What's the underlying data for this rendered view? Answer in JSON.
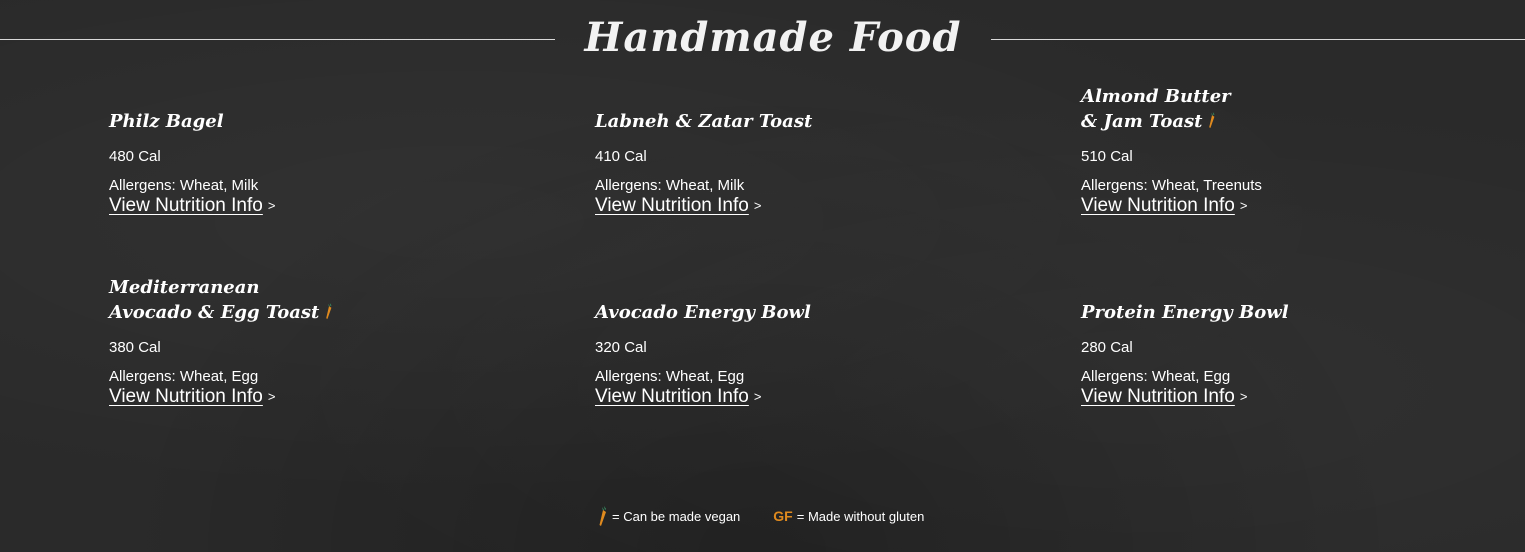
{
  "header": {
    "title": "Handmade Food"
  },
  "items": [
    {
      "name_line1": "Philz Bagel",
      "name_line2": "",
      "vegan": false,
      "calories": "480 Cal",
      "allergens": "Allergens: Wheat, Milk",
      "link": "View Nutrition Info",
      "chevron": ">"
    },
    {
      "name_line1": "Labneh & Zatar Toast",
      "name_line2": "",
      "vegan": false,
      "calories": "410 Cal",
      "allergens": "Allergens: Wheat, Milk",
      "link": "View Nutrition Info",
      "chevron": ">"
    },
    {
      "name_line1": "Almond Butter",
      "name_line2": "& Jam Toast",
      "vegan": true,
      "calories": "510 Cal",
      "allergens": "Allergens: Wheat, Treenuts",
      "link": "View Nutrition Info",
      "chevron": ">"
    },
    {
      "name_line1": "Mediterranean",
      "name_line2": "Avocado & Egg Toast",
      "vegan": true,
      "calories": "380 Cal",
      "allergens": "Allergens: Wheat, Egg",
      "link": "View Nutrition Info",
      "chevron": ">"
    },
    {
      "name_line1": "Avocado Energy Bowl",
      "name_line2": "",
      "vegan": false,
      "calories": "320 Cal",
      "allergens": "Allergens: Wheat, Egg",
      "link": "View Nutrition Info",
      "chevron": ">"
    },
    {
      "name_line1": "Protein Energy Bowl",
      "name_line2": "",
      "vegan": false,
      "calories": "280 Cal",
      "allergens": "Allergens: Wheat, Egg",
      "link": "View Nutrition Info",
      "chevron": ">"
    }
  ],
  "legend": {
    "vegan_text": "= Can be made vegan",
    "gf_mark": "GF",
    "gf_text": "= Made without gluten",
    "vegan_icon": "carrot-icon"
  },
  "colors": {
    "background": "#2a2a2a",
    "text": "#ffffff",
    "accent_orange": "#e08a1e",
    "carrot_green": "#3a9b6a"
  }
}
